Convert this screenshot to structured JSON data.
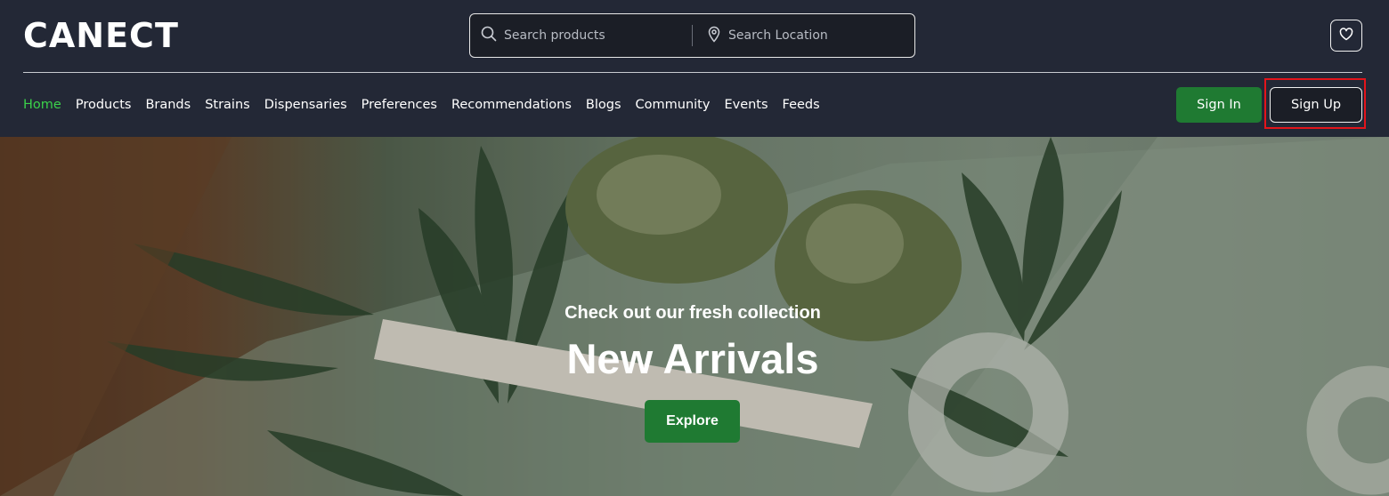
{
  "brand": {
    "logo_text": "CANECT"
  },
  "search": {
    "products_placeholder": "Search products",
    "location_placeholder": "Search Location"
  },
  "nav": {
    "items": [
      {
        "label": "Home",
        "active": true
      },
      {
        "label": "Products"
      },
      {
        "label": "Brands"
      },
      {
        "label": "Strains"
      },
      {
        "label": "Dispensaries"
      },
      {
        "label": "Preferences"
      },
      {
        "label": "Recommendations"
      },
      {
        "label": "Blogs"
      },
      {
        "label": "Community"
      },
      {
        "label": "Events"
      },
      {
        "label": "Feeds"
      }
    ]
  },
  "auth": {
    "sign_in": "Sign In",
    "sign_up": "Sign Up"
  },
  "hero": {
    "subtitle": "Check out our fresh collection",
    "title": "New Arrivals",
    "cta": "Explore"
  },
  "colors": {
    "header_bg": "#232836",
    "accent_green": "#1f7a32",
    "active_nav": "#3bd14a",
    "highlight_outline": "#e3141b"
  },
  "icons": [
    "search-icon",
    "location-pin-icon",
    "heart-icon"
  ]
}
